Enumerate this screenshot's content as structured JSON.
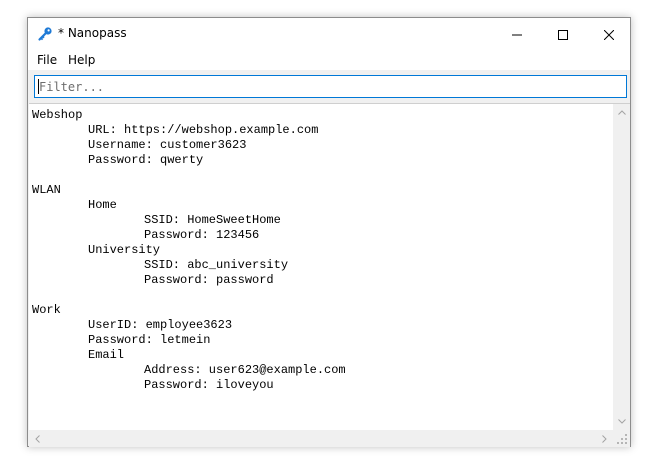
{
  "window": {
    "title": "* Nanopass",
    "icon": "key-icon",
    "accent_color": "#0078d7",
    "icon_color": "#1e7ad6"
  },
  "caption_buttons": {
    "minimize": "minimize-icon",
    "maximize": "maximize-icon",
    "close": "close-icon"
  },
  "menu": {
    "items": [
      "File",
      "Help"
    ]
  },
  "filter": {
    "placeholder": "Filter...",
    "value": ""
  },
  "entries": [
    {
      "indent": 0,
      "text": "Webshop"
    },
    {
      "indent": 1,
      "text": "URL: https://webshop.example.com"
    },
    {
      "indent": 1,
      "text": "Username: customer3623"
    },
    {
      "indent": 1,
      "text": "Password: qwerty"
    },
    {
      "indent": 0,
      "text": ""
    },
    {
      "indent": 0,
      "text": "WLAN"
    },
    {
      "indent": 1,
      "text": "Home"
    },
    {
      "indent": 2,
      "text": "SSID: HomeSweetHome"
    },
    {
      "indent": 2,
      "text": "Password: 123456"
    },
    {
      "indent": 1,
      "text": "University"
    },
    {
      "indent": 2,
      "text": "SSID: abc_university"
    },
    {
      "indent": 2,
      "text": "Password: password"
    },
    {
      "indent": 0,
      "text": ""
    },
    {
      "indent": 0,
      "text": "Work"
    },
    {
      "indent": 1,
      "text": "UserID: employee3623"
    },
    {
      "indent": 1,
      "text": "Password: letmein"
    },
    {
      "indent": 1,
      "text": "Email"
    },
    {
      "indent": 2,
      "text": "Address: user623@example.com"
    },
    {
      "indent": 2,
      "text": "Password: iloveyou"
    }
  ],
  "scrollbars": {
    "up": "scroll-up-arrow-icon",
    "down": "scroll-down-arrow-icon",
    "left": "scroll-left-arrow-icon",
    "right": "scroll-right-arrow-icon",
    "grip": "resize-grip-icon"
  }
}
